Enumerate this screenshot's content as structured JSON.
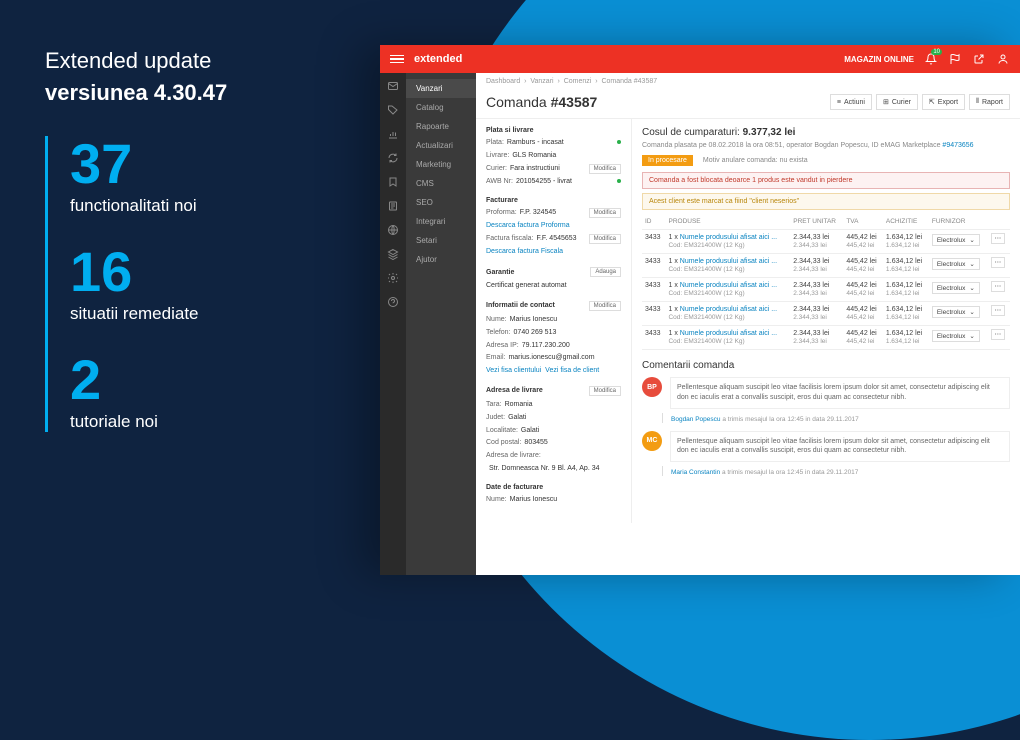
{
  "promo": {
    "title": "Extended update",
    "version": "versiunea 4.30.47",
    "stats": [
      {
        "num": "37",
        "label": "functionalitati noi"
      },
      {
        "num": "16",
        "label": "situatii remediate"
      },
      {
        "num": "2",
        "label": "tutoriale noi"
      }
    ]
  },
  "header": {
    "logo": "extended",
    "store_btn": "MAGAZIN ONLINE",
    "bell_badge": "10"
  },
  "sidebar": {
    "items": [
      "Vanzari",
      "Catalog",
      "Rapoarte",
      "Actualizari",
      "Marketing",
      "CMS",
      "SEO",
      "Integrari",
      "Setari",
      "Ajutor"
    ]
  },
  "breadcrumb": [
    "Dashboard",
    "Vanzari",
    "Comenzi",
    "Comanda #43587"
  ],
  "page": {
    "title_pre": "Comanda ",
    "title_num": "#43587",
    "actions": [
      "Actiuni",
      "Curier",
      "Export",
      "Raport"
    ]
  },
  "left": {
    "payment": {
      "title": "Plata si livrare",
      "plata_lbl": "Plata:",
      "plata_val": "Ramburs - incasat",
      "livrare_lbl": "Livrare:",
      "livrare_val": "GLS Romania",
      "curier_lbl": "Curier:",
      "curier_val": "Fara instructiuni",
      "awb_lbl": "AWB Nr:",
      "awb_val": "201054255 - livrat",
      "modif": "Modifica"
    },
    "invoice": {
      "title": "Facturare",
      "proforma_lbl": "Proforma:",
      "proforma_val": "F.P. 324545",
      "proforma_link": "Descarca factura Proforma",
      "fiscal_lbl": "Factura fiscala:",
      "fiscal_val": "F.F. 4545653",
      "fiscal_link": "Descarca factura Fiscala",
      "modif": "Modifica"
    },
    "warranty": {
      "title": "Garantie",
      "text": "Certificat generat automat",
      "tag": "Adauga"
    },
    "contact": {
      "title": "Informatii de contact",
      "nume_lbl": "Nume:",
      "nume_val": "Marius Ionescu",
      "tel_lbl": "Telefon:",
      "tel_val": "0740 269 513",
      "ip_lbl": "Adresa IP:",
      "ip_val": "79.117.230.200",
      "email_lbl": "Email:",
      "email_val": "marius.ionescu@gmail.com",
      "link1": "Vezi fisa clientului",
      "link2": "Vezi fisa de client",
      "modif": "Modifica"
    },
    "delivery": {
      "title": "Adresa de livrare",
      "tara_lbl": "Tara:",
      "tara_val": "Romania",
      "judet_lbl": "Judet:",
      "judet_val": "Galati",
      "loc_lbl": "Localitate:",
      "loc_val": "Galati",
      "cod_lbl": "Cod postal:",
      "cod_val": "803455",
      "adr_lbl": "Adresa de livrare:",
      "adr_val": "Str. Domneasca Nr. 9 Bl. A4, Ap. 34",
      "modif": "Modifica"
    },
    "billing": {
      "title": "Date de facturare",
      "nume_lbl": "Nume:",
      "nume_val": "Marius Ionescu"
    }
  },
  "cart": {
    "title_pre": "Cosul de cumparaturi: ",
    "total": "9.377,32 lei",
    "sub_pre": "Comanda plasata pe 08.02.2018 la ora 08:51, operator Bogdan Popescu, ID eMAG Marketplace ",
    "sub_link": "#9473656",
    "status": "In procesare",
    "status_note": "Motiv anulare comanda: nu exista",
    "alert_red": "Comanda a fost blocata deoarce 1 produs este vandut in pierdere",
    "alert_orange": "Acest client este marcat ca fiind \"client neserios\"",
    "cols": [
      "ID",
      "PRODUSE",
      "PRET UNITAR",
      "TVA",
      "ACHIZITIE",
      "FURNIZOR"
    ],
    "qty": "1 x ",
    "prod_link": "Numele produsului afisat aici ...",
    "prod_sub": "Cod: EM321400W (12 Kg)",
    "supplier": "Electrolux",
    "rows": [
      {
        "id": "3433",
        "p1": "2.344,33 lei",
        "p2": "2.344,33 lei",
        "t1": "445,42 lei",
        "t2": "445,42 lei",
        "a1": "1.634,12 lei",
        "a2": "1.634,12 lei"
      },
      {
        "id": "3433",
        "p1": "2.344,33 lei",
        "p2": "2.344,33 lei",
        "t1": "445,42 lei",
        "t2": "445,42 lei",
        "a1": "1.634,12 lei",
        "a2": "1.634,12 lei"
      },
      {
        "id": "3433",
        "p1": "2.344,33 lei",
        "p2": "2.344,33 lei",
        "t1": "445,42 lei",
        "t2": "445,42 lei",
        "a1": "1.634,12 lei",
        "a2": "1.634,12 lei"
      },
      {
        "id": "3433",
        "p1": "2.344,33 lei",
        "p2": "2.344,33 lei",
        "t1": "445,42 lei",
        "t2": "445,42 lei",
        "a1": "1.634,12 lei",
        "a2": "1.634,12 lei"
      },
      {
        "id": "3433",
        "p1": "2.344,33 lei",
        "p2": "2.344,33 lei",
        "t1": "445,42 lei",
        "t2": "445,42 lei",
        "a1": "1.634,12 lei",
        "a2": "1.634,12 lei"
      }
    ]
  },
  "comments": {
    "title": "Comentarii comanda",
    "text": "Pellentesque aliquam suscipit leo vitae facilisis lorem ipsum dolor sit amet, consectetur adipiscing elit don ec iaculis erat a convallis suscipit, eros dui quam ac consectetur nibh.",
    "items": [
      {
        "av": "BP",
        "av_cls": "av-red",
        "author": "Bogdan Popescu",
        "meta": " a trimis mesajul la ora 12:45 in data 29.11.2017"
      },
      {
        "av": "MC",
        "av_cls": "av-orange",
        "author": "Maria Constantin",
        "meta": " a trimis mesajul la ora 12:45 in data 29.11.2017"
      }
    ]
  }
}
